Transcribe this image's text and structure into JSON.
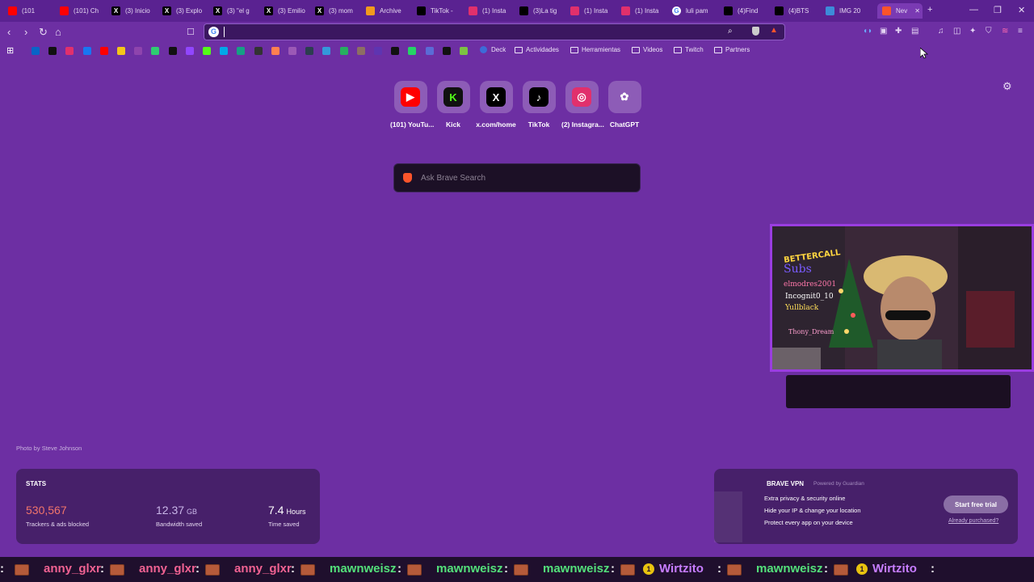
{
  "tabs": [
    {
      "label": "(101",
      "icon": "youtube-icon",
      "color": "#ff0000"
    },
    {
      "label": "(101) Ch",
      "icon": "youtube-icon",
      "color": "#ff0000"
    },
    {
      "label": "(3) Inicio",
      "icon": "x-icon",
      "color": "#000000"
    },
    {
      "label": "(3) Explo",
      "icon": "x-icon",
      "color": "#000000"
    },
    {
      "label": "(3) \"el g",
      "icon": "x-icon",
      "color": "#000000"
    },
    {
      "label": "(3) Emilio",
      "icon": "x-icon",
      "color": "#000000"
    },
    {
      "label": "(3) mom",
      "icon": "x-icon",
      "color": "#000000"
    },
    {
      "label": "Archive",
      "icon": "archive-icon",
      "color": "#f29a1d"
    },
    {
      "label": "TikTok -",
      "icon": "tiktok-icon",
      "color": "#000000"
    },
    {
      "label": "(1) Insta",
      "icon": "instagram-icon",
      "color": "#e1306c"
    },
    {
      "label": "(3)La tig",
      "icon": "tiktok-icon",
      "color": "#000000"
    },
    {
      "label": "(1) Insta",
      "icon": "instagram-icon",
      "color": "#e1306c"
    },
    {
      "label": "(1) Insta",
      "icon": "instagram-icon",
      "color": "#e1306c"
    },
    {
      "label": "luli pam",
      "icon": "google-icon",
      "color": "#ffffff"
    },
    {
      "label": "(4)Find",
      "icon": "tiktok-icon",
      "color": "#000000"
    },
    {
      "label": "(4)BTS",
      "icon": "tiktok-icon",
      "color": "#000000"
    },
    {
      "label": "IMG 20",
      "icon": "image-icon",
      "color": "#3d8bd9"
    },
    {
      "label": "Nev",
      "icon": "brave-icon",
      "color": "#fb542b"
    }
  ],
  "omnibox": {
    "value": ""
  },
  "bookmarks": {
    "favicons": [
      {
        "icon": "outlook-icon",
        "color": "#0a64c7"
      },
      {
        "icon": "tiktok-icon",
        "color": "#111111"
      },
      {
        "icon": "instagram-icon",
        "color": "#e1306c"
      },
      {
        "icon": "facebook-icon",
        "color": "#1877f2"
      },
      {
        "icon": "youtube-icon",
        "color": "#ff0000"
      },
      {
        "icon": "bookmark-icon",
        "color": "#f5c518"
      },
      {
        "icon": "bookmark-icon",
        "color": "#8e44ad"
      },
      {
        "icon": "bookmark-icon",
        "color": "#2ecc71"
      },
      {
        "icon": "x-icon",
        "color": "#111111"
      },
      {
        "icon": "twitch-icon",
        "color": "#9146ff"
      },
      {
        "icon": "kick-icon",
        "color": "#53fc18"
      },
      {
        "icon": "bookmark-icon",
        "color": "#00a8e8"
      },
      {
        "icon": "bookmark-icon",
        "color": "#16a085"
      },
      {
        "icon": "bookmark-icon",
        "color": "#333333"
      },
      {
        "icon": "bookmark-icon",
        "color": "#ff7f50"
      },
      {
        "icon": "bookmark-icon",
        "color": "#9b59b6"
      },
      {
        "icon": "bookmark-icon",
        "color": "#2c3e50"
      },
      {
        "icon": "bookmark-icon",
        "color": "#3498db"
      },
      {
        "icon": "bookmark-icon",
        "color": "#27ae60"
      },
      {
        "icon": "bookmark-icon",
        "color": "#8d6e63"
      },
      {
        "icon": "bookmark-icon",
        "color": "#5e35b1"
      },
      {
        "icon": "bookmark-icon",
        "color": "#111111"
      },
      {
        "icon": "whatsapp-icon",
        "color": "#25d366"
      },
      {
        "icon": "bookmark-icon",
        "color": "#5b6bd6"
      },
      {
        "icon": "bookmark-icon",
        "color": "#111111"
      },
      {
        "icon": "bookmark-icon",
        "color": "#7cc243"
      }
    ],
    "deck_label": "Deck",
    "folders": [
      "Actividades",
      "Herramientas",
      "Videos",
      "Twitch",
      "Partners"
    ]
  },
  "top_sites": [
    {
      "label": "(101) YouTu...",
      "icon": "youtube-icon",
      "color": "#ff0000"
    },
    {
      "label": "Kick",
      "icon": "kick-icon",
      "color": "#53fc18"
    },
    {
      "label": "x.com/home",
      "icon": "x-icon",
      "color": "#000000"
    },
    {
      "label": "TikTok",
      "icon": "tiktok-icon",
      "color": "#000000"
    },
    {
      "label": "(2) Instagra...",
      "icon": "instagram-icon",
      "color": "#e1306c"
    },
    {
      "label": "ChatGPT",
      "icon": "chatgpt-icon",
      "color": "#ffffff"
    }
  ],
  "search": {
    "placeholder": "Ask Brave Search"
  },
  "photo_credit": "Photo by Steve Johnson",
  "stats": {
    "title": "STATS",
    "trackers": {
      "value": "530,567",
      "label": "Trackers & ads blocked",
      "color": "#f2756b"
    },
    "bandwidth": {
      "value": "12.37",
      "unit": "GB",
      "label": "Bandwidth saved",
      "color": "#c9b6e8"
    },
    "time": {
      "value": "7.4",
      "unit": "Hours",
      "label": "Time saved",
      "color": "#ffffff"
    }
  },
  "vpn": {
    "title": "BRAVE VPN",
    "powered": "Powered by Guardian",
    "lines": [
      "Extra privacy & security online",
      "Hide your IP & change your location",
      "Protect every app on your device"
    ],
    "button": "Start free trial",
    "link": "Already purchased?"
  },
  "webcam": {
    "overlay_text": "BETTERCALL",
    "board_lines": [
      "Subs",
      "elmodres2001",
      "Incognit0_10",
      "Yullblack",
      "Thony_Dream"
    ]
  },
  "ticker": [
    {
      "name": "anny_glxr",
      "color": "#f06292"
    },
    {
      "name": "anny_glxr",
      "color": "#f06292"
    },
    {
      "name": "anny_glxr",
      "color": "#f06292"
    },
    {
      "name": "mawnweisz",
      "color": "#53e07a"
    },
    {
      "name": "mawnweisz",
      "color": "#53e07a"
    },
    {
      "name": "mawnweisz",
      "color": "#53e07a"
    },
    {
      "name": "Wirtzito",
      "color": "#c77dff"
    },
    {
      "name": "mawnweisz",
      "color": "#53e07a"
    },
    {
      "name": "Wirtzito",
      "color": "#c77dff"
    }
  ],
  "ticker_badge": "1"
}
